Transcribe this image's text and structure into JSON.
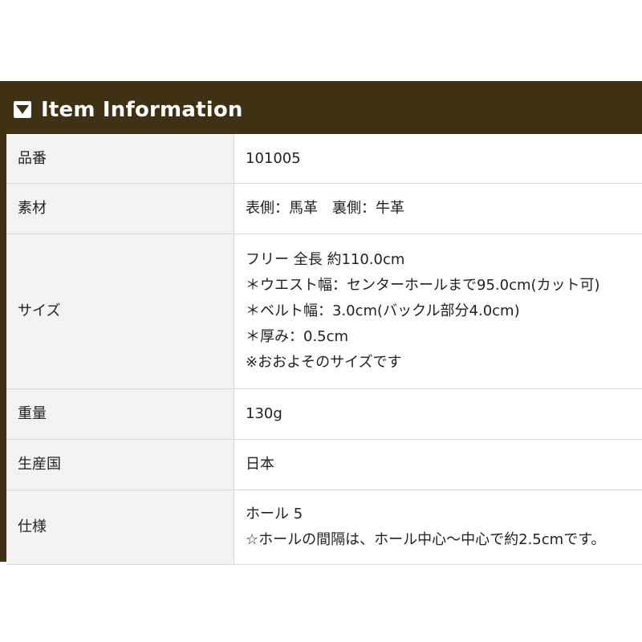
{
  "header": {
    "title": "Item Information",
    "icon": "triangle-down-icon",
    "background_color": "#3f3113"
  },
  "rows": [
    {
      "label": "品番",
      "lines": [
        "101005"
      ]
    },
    {
      "label": "素材",
      "lines": [
        "表側：馬革　裏側：牛革"
      ]
    },
    {
      "label": "サイズ",
      "lines": [
        "フリー 全長 約110.0cm",
        "＊ウエスト幅：センターホールまで95.0cm(カット可)",
        "＊ベルト幅：3.0cm(バックル部分4.0cm)",
        "＊厚み：0.5cm",
        "※おおよそのサイズです"
      ]
    },
    {
      "label": "重量",
      "lines": [
        "130g"
      ]
    },
    {
      "label": "生産国",
      "lines": [
        "日本"
      ]
    },
    {
      "label": "仕様",
      "lines": [
        "ホール 5",
        "☆ホールの間隔は、ホール中心〜中心で約2.5cmです。"
      ]
    }
  ]
}
